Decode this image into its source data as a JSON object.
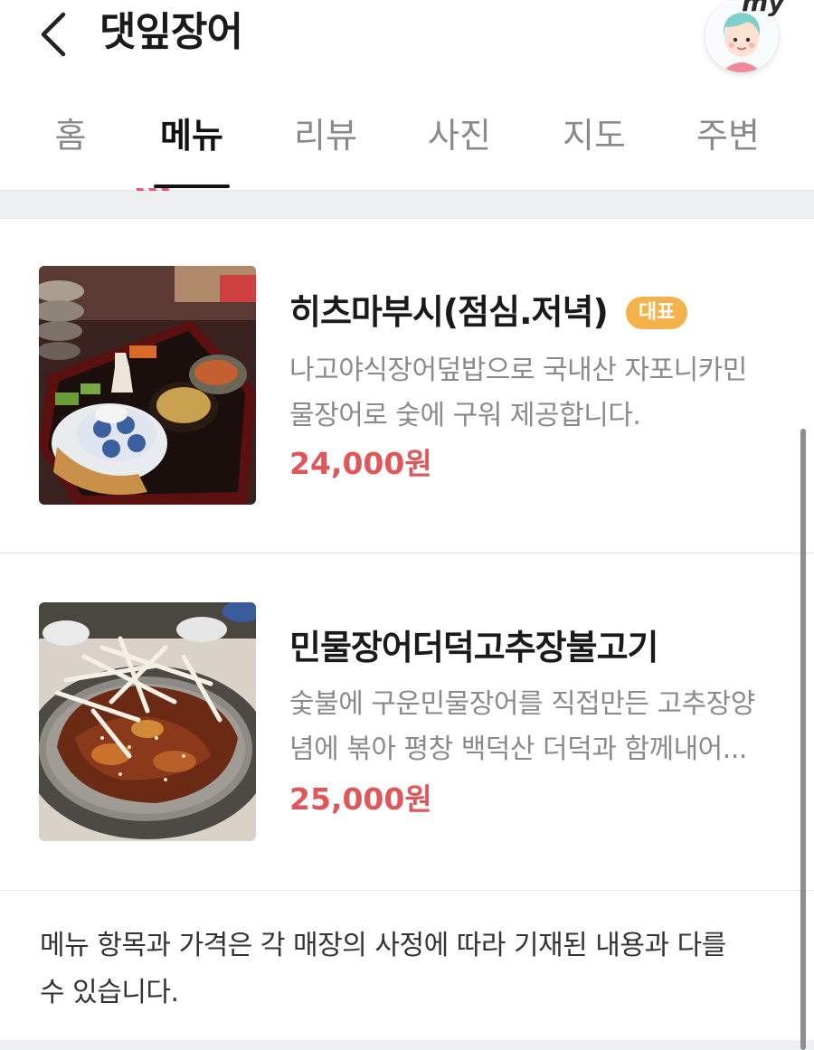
{
  "header": {
    "title": "댓잎장어",
    "back_icon": "chevron-left-icon",
    "avatar_label": "my"
  },
  "tabs": [
    {
      "label": "홈",
      "active": false
    },
    {
      "label": "메뉴",
      "active": true
    },
    {
      "label": "리뷰",
      "active": false
    },
    {
      "label": "사진",
      "active": false
    },
    {
      "label": "지도",
      "active": false
    },
    {
      "label": "주변",
      "active": false
    }
  ],
  "menu": [
    {
      "name": "히츠마부시(점심.저녁)",
      "badge": "대표",
      "desc_line1": "나고야식장어덮밥으로 국내산 자포니카민",
      "desc_line2": "물장어로 숯에 구워 제공합니다.",
      "price": "24,000원"
    },
    {
      "name": "민물장어더덕고추장불고기",
      "badge": "",
      "desc_line1": "숯불에 구운민물장어를 직접만든 고추장양",
      "desc_line2": "념에 볶아 평창 백덕산 더덕과 함께내어...",
      "price": "25,000원"
    }
  ],
  "notice": {
    "line1": "메뉴 항목과 가격은 각 매장의 사정에 따라 기재된 내용과 다를",
    "line2": "수 있습니다."
  },
  "colors": {
    "price": "#e0575a",
    "badge": "#f3b24c",
    "active_tab": "#111111",
    "inactive_tab": "#8a8a8a"
  }
}
